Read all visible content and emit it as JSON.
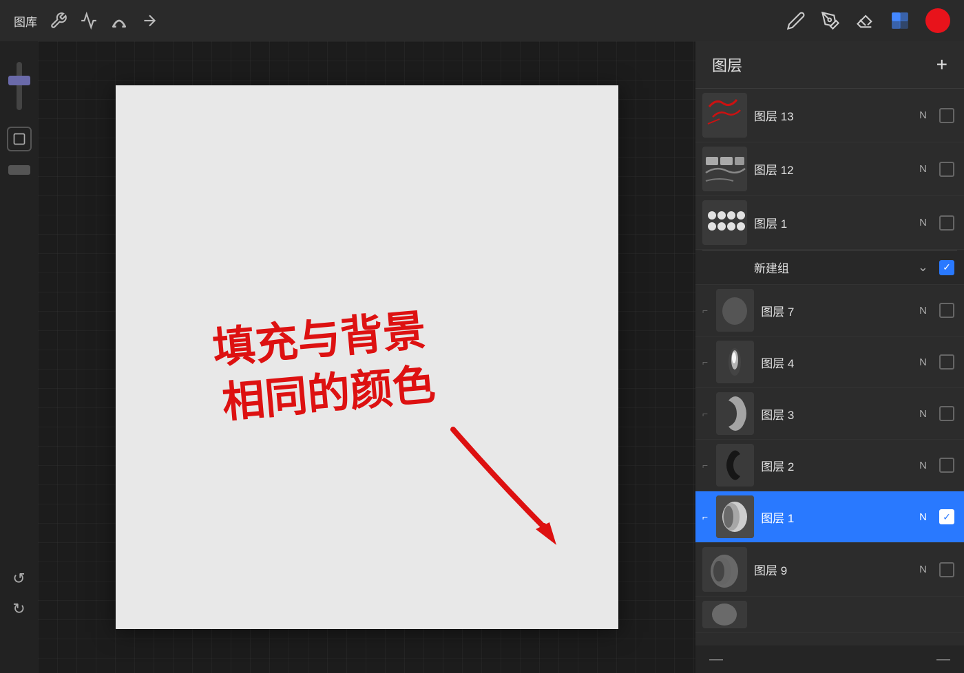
{
  "toolbar": {
    "gallery_label": "图库",
    "tools": [
      "wrench",
      "magic",
      "s-curve",
      "arrow"
    ],
    "right_tools": [
      "pen",
      "marker",
      "eraser",
      "layers",
      "color"
    ]
  },
  "layers_panel": {
    "title": "图层",
    "add_label": "+",
    "layers": [
      {
        "id": "layer13",
        "name": "图层 13",
        "mode": "N",
        "checked": false,
        "thumb_type": "red_lines",
        "active": false
      },
      {
        "id": "layer12",
        "name": "图层 12",
        "mode": "N",
        "checked": false,
        "thumb_type": "gray_shapes",
        "active": false
      },
      {
        "id": "layer1a",
        "name": "图层 1",
        "mode": "N",
        "checked": false,
        "thumb_type": "dots",
        "active": false
      },
      {
        "id": "group1",
        "name": "新建组",
        "mode": "",
        "checked": true,
        "thumb_type": "group",
        "active": false,
        "is_group": true
      },
      {
        "id": "layer7",
        "name": "图层 7",
        "mode": "N",
        "checked": false,
        "thumb_type": "dark_shape",
        "active": false,
        "indent": true
      },
      {
        "id": "layer4",
        "name": "图层 4",
        "mode": "N",
        "checked": false,
        "thumb_type": "white_blur",
        "active": false,
        "indent": true
      },
      {
        "id": "layer3",
        "name": "图层 3",
        "mode": "N",
        "checked": false,
        "thumb_type": "crescent",
        "active": false,
        "indent": true
      },
      {
        "id": "layer2",
        "name": "图层 2",
        "mode": "N",
        "checked": false,
        "thumb_type": "black_shape",
        "active": false,
        "indent": true
      },
      {
        "id": "layer1b",
        "name": "图层 1",
        "mode": "N",
        "checked": true,
        "thumb_type": "oval_gray",
        "active": true,
        "indent": true
      },
      {
        "id": "layer9",
        "name": "图层 9",
        "mode": "N",
        "checked": false,
        "thumb_type": "partial",
        "active": false
      }
    ]
  },
  "canvas": {
    "annotation_text_line1": "填充与背景",
    "annotation_text_line2": "相同的颜色"
  },
  "sidebar": {
    "undo_label": "↩",
    "redo_label": "↪"
  }
}
